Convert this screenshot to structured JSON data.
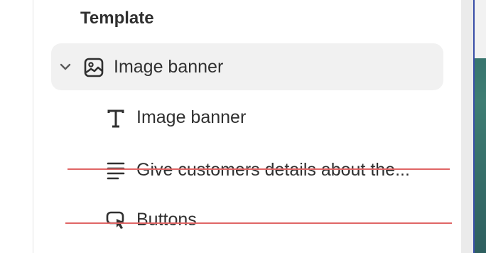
{
  "section": {
    "title": "Template"
  },
  "block": {
    "label": "Image banner",
    "icon": "image-icon",
    "expanded": true,
    "children": [
      {
        "label": "Image banner",
        "icon": "text-icon",
        "hidden": false
      },
      {
        "label": "Give customers details about the...",
        "icon": "paragraph-icon",
        "hidden": true
      },
      {
        "label": "Buttons",
        "icon": "button-pointer-icon",
        "hidden": true
      }
    ]
  },
  "colors": {
    "text": "#303030",
    "selected_bg": "#f1f1f1",
    "strike": "#e06666"
  }
}
